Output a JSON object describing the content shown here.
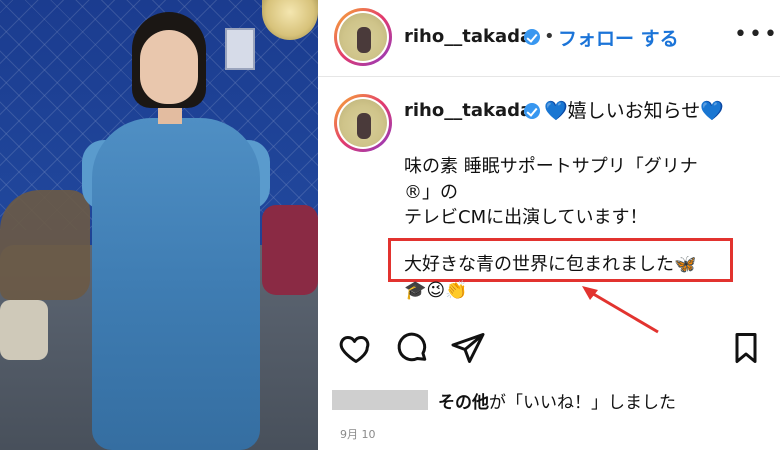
{
  "post": {
    "username": "riho__takada",
    "follow_label": "フォロー する",
    "more_label": "•••",
    "dot": "•",
    "caption": {
      "first": "💙嬉しいお知らせ💙",
      "line1": "味の素 睡眠サポートサプリ「グリナ",
      "line2": "®」の",
      "line3": "テレビCMに出演しています！",
      "highlighted": "大好きな青の世界に包まれました🦋",
      "emojis": "🎓😉👏"
    },
    "likes": {
      "bold": "その他",
      "rest": "が「いいね！」しました"
    },
    "date": "9月 10"
  },
  "colors": {
    "follow": "#1b74d8",
    "highlight_box": "#e2332f",
    "verified": "#3897f0"
  },
  "icons": [
    "heart-icon",
    "comment-icon",
    "share-icon",
    "bookmark-icon",
    "verified-icon",
    "more-icon"
  ]
}
